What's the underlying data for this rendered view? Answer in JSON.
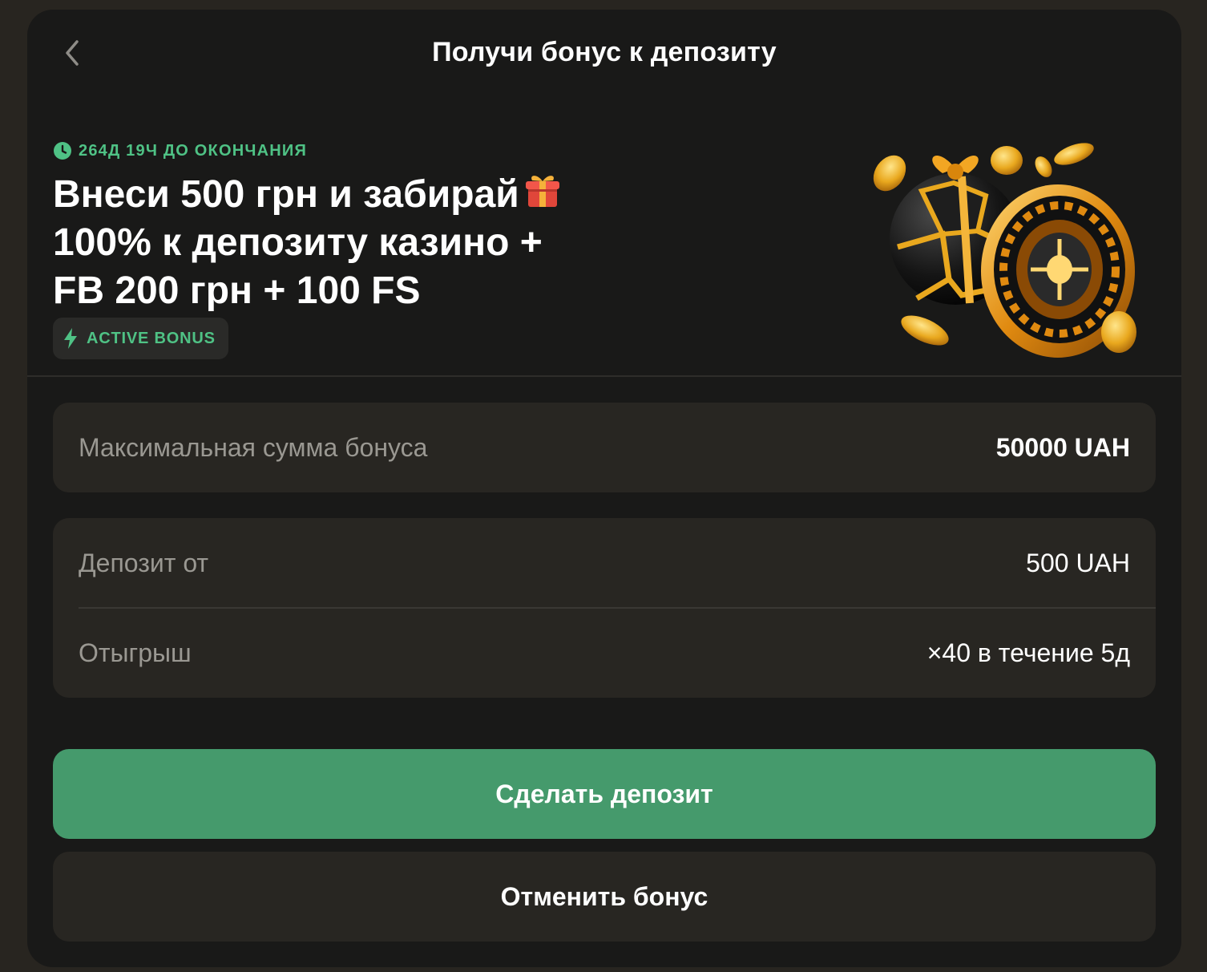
{
  "modal": {
    "title": "Получи бонус к депозиту"
  },
  "promo": {
    "timer": "264Д 19Ч ДО ОКОНЧАНИЯ",
    "headline_line1": "Внеси 500 грн и забирай",
    "headline_line2": "100% к депозиту казино +",
    "headline_line3": "FB 200 грн + 100 FS",
    "badge": "ACTIVE BONUS",
    "illustration": "football-roulette-coins"
  },
  "details": {
    "max_bonus_label": "Максимальная сумма бонуса",
    "max_bonus_value": "50000 UAH",
    "deposit_label": "Депозит от",
    "deposit_value": "500 UAH",
    "wager_label": "Отыгрыш",
    "wager_value": "×40 в течение 5д"
  },
  "actions": {
    "deposit_button": "Сделать депозит",
    "cancel_button": "Отменить бонус"
  },
  "colors": {
    "accent": "#459a6c",
    "accent_text": "#4fc285",
    "modal_bg": "#191918",
    "card_bg": "#282622"
  }
}
